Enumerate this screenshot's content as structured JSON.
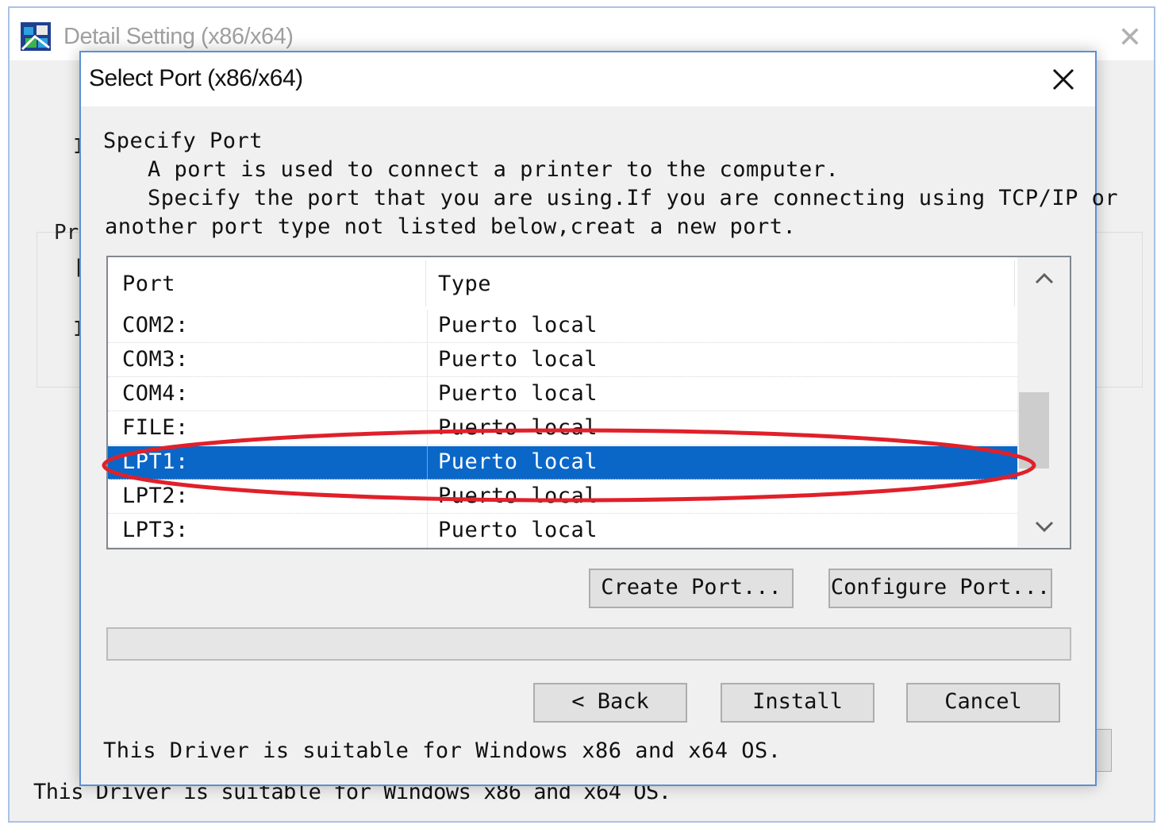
{
  "parent_window": {
    "title": "Detail Setting (x86/x64)",
    "close_glyph": "✕",
    "fragments": [
      "I",
      "Pr",
      "[",
      "I"
    ],
    "footer": "This Driver is suitable for Windows x86 and x64 OS."
  },
  "dialog": {
    "title": "Select Port (x86/x64)",
    "heading": "Specify Port",
    "description": [
      "A port is used to connect a printer to the computer.",
      "Specify the port that you are using.If you are connecting using TCP/IP or",
      "another port type not listed below,creat a new port."
    ],
    "list": {
      "columns": [
        "Port",
        "Type"
      ],
      "rows": [
        {
          "port": "COM2:",
          "type": "Puerto local"
        },
        {
          "port": "COM3:",
          "type": "Puerto local"
        },
        {
          "port": "COM4:",
          "type": "Puerto local"
        },
        {
          "port": "FILE:",
          "type": "Puerto local"
        },
        {
          "port": "LPT1:",
          "type": "Puerto local"
        },
        {
          "port": "LPT2:",
          "type": "Puerto local"
        },
        {
          "port": "LPT3:",
          "type": "Puerto local"
        }
      ],
      "selected_port": "LPT1:",
      "selection_color": "#0a67c8"
    },
    "buttons": {
      "create_port": "Create Port...",
      "configure_port": "Configure Port...",
      "back": "< Back",
      "install": "Install",
      "cancel": "Cancel"
    },
    "footer": "This Driver is suitable for Windows x86 and x64 OS."
  },
  "annotation_color": "#e0202a"
}
